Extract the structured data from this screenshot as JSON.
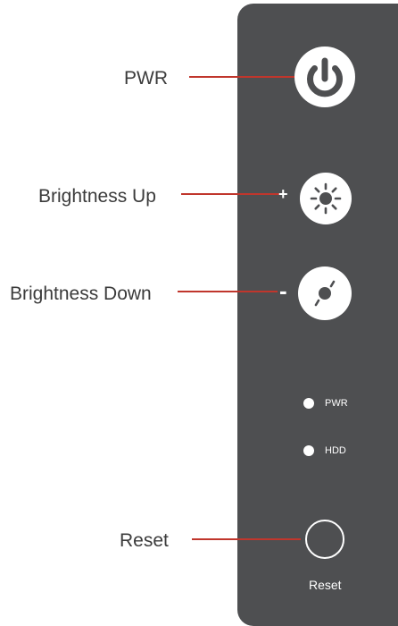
{
  "callouts": {
    "pwr": "PWR",
    "brightness_up": "Brightness Up",
    "brightness_down": "Brightness Down",
    "reset": "Reset"
  },
  "panel": {
    "plus_sign": "+",
    "minus_sign": "-",
    "led_pwr": "PWR",
    "led_hdd": "HDD",
    "reset_label": "Reset"
  },
  "colors": {
    "panel": "#4e4f51",
    "leader_line": "#c0362c",
    "label_text": "#3b3b3b",
    "panel_glyphs": "#ffffff"
  },
  "icons": {
    "power": "power-icon",
    "brightness_up": "sun-bright-icon",
    "brightness_down": "sun-dim-icon"
  }
}
